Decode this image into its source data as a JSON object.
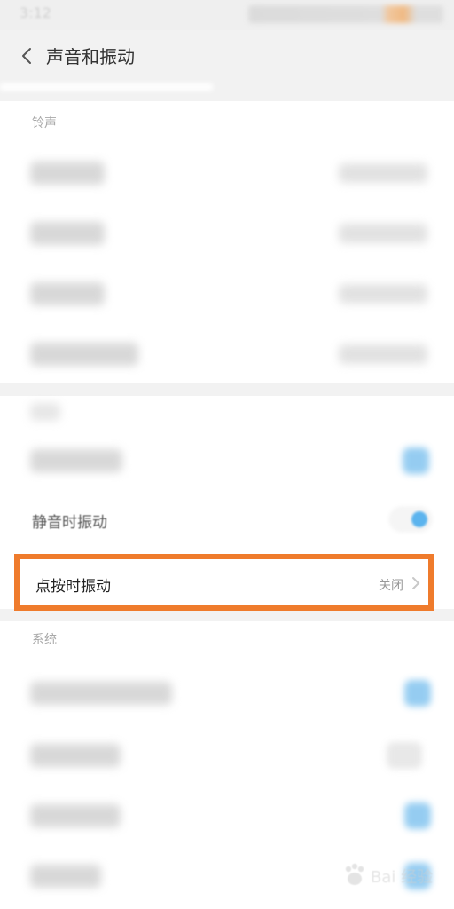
{
  "status_bar": {
    "time": "3:12"
  },
  "header": {
    "title": "声音和振动"
  },
  "sections": {
    "ringtone": {
      "title": "铃声"
    },
    "vibration": {
      "items": [
        {
          "label": "静音时振动",
          "toggle": "on"
        },
        {
          "label": "点按时振动",
          "value": "关闭"
        }
      ]
    },
    "system": {
      "title": "系统"
    }
  },
  "watermark": {
    "text": "Bai 经验"
  },
  "colors": {
    "highlight": "#ef7b2c",
    "toggle_on": "#5cb4ee"
  }
}
